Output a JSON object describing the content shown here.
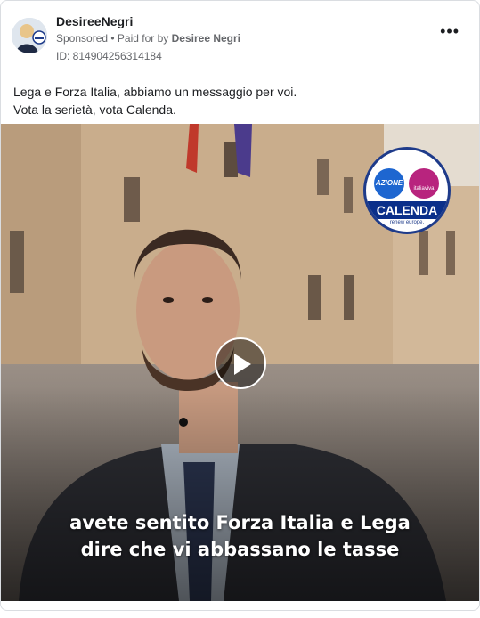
{
  "post": {
    "page_name": "DesireeNegri",
    "sponsored_label": "Sponsored",
    "separator": " • ",
    "paid_for_label": "Paid for by ",
    "paid_for_name": "Desiree Negri",
    "ad_id": "ID: 814904256314184",
    "more_icon": "more-horizontal-icon",
    "more_label": "•••",
    "text_line1": "Lega e Forza Italia, abbiamo un messaggio per voi.",
    "text_line2": "Vota la serietà, vota Calenda."
  },
  "video": {
    "caption_line1": "avete sentito Forza Italia e Lega",
    "caption_line2": "dire che vi abbassano le tasse",
    "play_icon": "play-icon",
    "logo": {
      "azione": "AZIONE",
      "italia_viva": "italiaviva",
      "calenda": "CALENDA",
      "renew": "renew europe."
    }
  }
}
